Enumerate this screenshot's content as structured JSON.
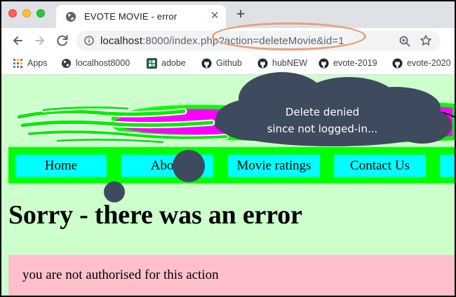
{
  "browser": {
    "tab": {
      "title": "EVOTE MOVIE - error",
      "close_glyph": "✕"
    },
    "new_tab_glyph": "+",
    "address_bar": {
      "host": "localhost",
      "rest": ":8000/index.php?action=deleteMovie&id=1"
    },
    "bookmarks": [
      {
        "label": "Apps",
        "icon": "apps-grid-icon"
      },
      {
        "label": "localhost8000",
        "icon": "globe-icon"
      },
      {
        "label": "adobe",
        "icon": "adobe-app-icon"
      },
      {
        "label": "Github",
        "icon": "github-icon"
      },
      {
        "label": "hubNEW",
        "icon": "github-icon"
      },
      {
        "label": "evote-2019",
        "icon": "github-icon"
      },
      {
        "label": "evote-2020",
        "icon": "github-icon"
      }
    ]
  },
  "page": {
    "nav": [
      "Home",
      "About",
      "Movie ratings",
      "Contact Us"
    ],
    "heading": "Sorry - there was an error",
    "message": "you are not authorised for this action"
  },
  "annotation": {
    "callout_line1": "Delete denied",
    "callout_line2": "since not logged-in..."
  },
  "colors": {
    "page_bg": "#ccffcc",
    "nav_bar": "#00ff00",
    "nav_item": "#00ffff",
    "error_box": "#ffc0cb",
    "banner_magenta": "#ff00ff",
    "callout_bg": "#3e4a5e",
    "highlight_ring": "#e8a07a"
  }
}
